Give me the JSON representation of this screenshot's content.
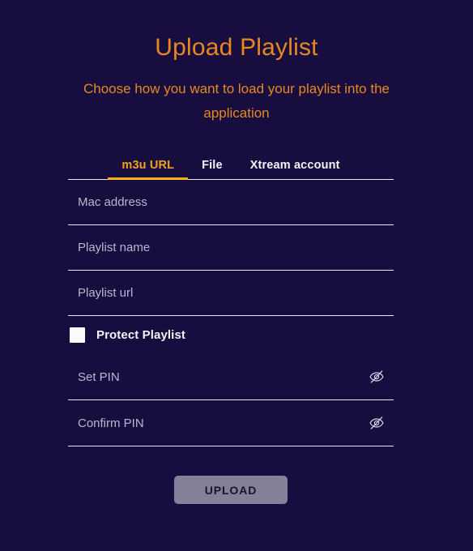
{
  "header": {
    "title": "Upload Playlist",
    "subtitle": "Choose how you want to load your playlist into the application"
  },
  "tabs": [
    {
      "label": "m3u URL",
      "active": true
    },
    {
      "label": "File",
      "active": false
    },
    {
      "label": "Xtream account",
      "active": false
    }
  ],
  "form": {
    "fields": [
      {
        "name": "mac-address",
        "placeholder": "Mac address",
        "value": ""
      },
      {
        "name": "playlist-name",
        "placeholder": "Playlist name",
        "value": ""
      },
      {
        "name": "playlist-url",
        "placeholder": "Playlist url",
        "value": ""
      }
    ],
    "protect": {
      "label": "Protect Playlist",
      "checked": false
    },
    "pin_fields": [
      {
        "name": "set-pin",
        "placeholder": "Set PIN",
        "value": "",
        "toggle_icon": "eye-slash-icon"
      },
      {
        "name": "confirm-pin",
        "placeholder": "Confirm PIN",
        "value": "",
        "toggle_icon": "eye-slash-icon"
      }
    ],
    "submit_label": "UPLOAD"
  },
  "colors": {
    "background": "#170e3f",
    "accent_orange": "#e8871f",
    "tab_active": "#f0a11c",
    "tab_underline": "#f5b117",
    "rule": "#e9e9f2",
    "placeholder": "#b5b9cf",
    "button_bg": "#83819a",
    "button_text": "#17122e"
  }
}
